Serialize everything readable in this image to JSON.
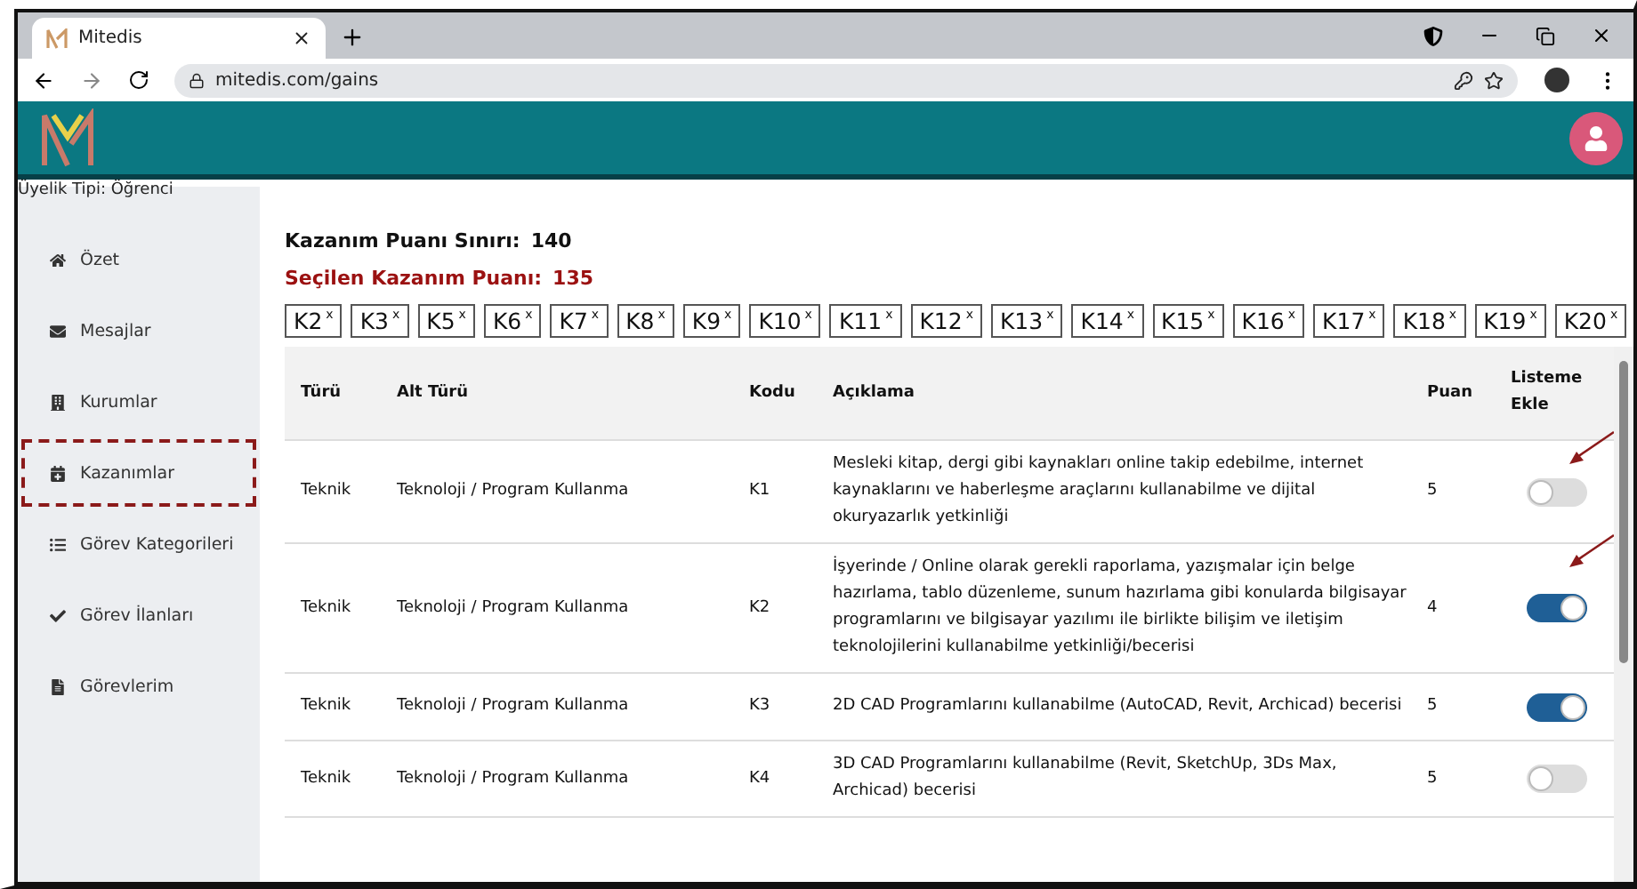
{
  "browser": {
    "tab_title": "Mitedis",
    "url": "mitedis.com/gains"
  },
  "membership": "Üyelik Tipi: Öğrenci",
  "sidebar": {
    "items": [
      {
        "label": "Özet",
        "selected": false
      },
      {
        "label": "Mesajlar",
        "selected": false
      },
      {
        "label": "Kurumlar",
        "selected": false
      },
      {
        "label": "Kazanımlar",
        "selected": true
      },
      {
        "label": "Görev Kategorileri",
        "selected": false
      },
      {
        "label": "Görev İlanları",
        "selected": false
      },
      {
        "label": "Görevlerim",
        "selected": false
      }
    ]
  },
  "summary": {
    "limit_label": "Kazanım Puanı Sınırı:",
    "limit_value": "140",
    "selected_label": "Seçilen Kazanım Puanı:",
    "selected_value": "135"
  },
  "tags": [
    {
      "label": "K2",
      "remove": "x"
    },
    {
      "label": "K3",
      "remove": "x"
    },
    {
      "label": "K5",
      "remove": "x"
    },
    {
      "label": "K6",
      "remove": "x"
    },
    {
      "label": "K7",
      "remove": "x"
    },
    {
      "label": "K8",
      "remove": "x"
    },
    {
      "label": "K9",
      "remove": "x"
    },
    {
      "label": "K10",
      "remove": "x"
    },
    {
      "label": "K11",
      "remove": "x"
    },
    {
      "label": "K12",
      "remove": "x"
    },
    {
      "label": "K13",
      "remove": "x"
    },
    {
      "label": "K14",
      "remove": "x"
    },
    {
      "label": "K15",
      "remove": "x"
    },
    {
      "label": "K16",
      "remove": "x"
    },
    {
      "label": "K17",
      "remove": "x"
    },
    {
      "label": "K18",
      "remove": "x"
    },
    {
      "label": "K19",
      "remove": "x"
    },
    {
      "label": "K20",
      "remove": "x"
    }
  ],
  "table": {
    "columns": [
      "Türü",
      "Alt Türü",
      "Kodu",
      "Açıklama",
      "Puan",
      "Listeme Ekle"
    ],
    "rows": [
      {
        "type": "Teknik",
        "subtype": "Teknoloji / Program Kullanma",
        "code": "K1",
        "description": "Mesleki kitap, dergi gibi kaynakları online takip edebilme, internet kaynaklarını ve haberleşme araçlarını kullanabilme ve dijital okuryazarlık yetkinliği",
        "points": "5",
        "on": false,
        "annotated": true
      },
      {
        "type": "Teknik",
        "subtype": "Teknoloji / Program Kullanma",
        "code": "K2",
        "description": "İşyerinde / Online olarak gerekli raporlama, yazışmalar için belge hazırlama, tablo düzenleme, sunum hazırlama gibi konularda bilgisayar programlarını ve bilgisayar yazılımı ile birlikte bilişim ve iletişim teknolojilerini kullanabilme yetkinliği/becerisi",
        "points": "4",
        "on": true,
        "annotated": true
      },
      {
        "type": "Teknik",
        "subtype": "Teknoloji / Program Kullanma",
        "code": "K3",
        "description": "2D CAD Programlarını kullanabilme (AutoCAD, Revit, Archicad) becerisi",
        "points": "5",
        "on": true,
        "annotated": false
      },
      {
        "type": "Teknik",
        "subtype": "Teknoloji / Program Kullanma",
        "code": "K4",
        "description": "3D CAD Programlarını kullanabilme (Revit, SketchUp, 3Ds Max, Archicad) becerisi",
        "points": "5",
        "on": false,
        "annotated": false
      }
    ]
  }
}
